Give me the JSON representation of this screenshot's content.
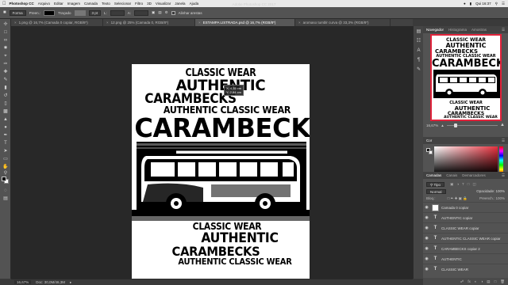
{
  "menubar": {
    "apple_icon": "apple-icon",
    "app_name": "Photoshop CC",
    "items": [
      "Arquivo",
      "Editar",
      "Imagem",
      "Camada",
      "Texto",
      "Selecionar",
      "Filtro",
      "3D",
      "Visualizar",
      "Janela",
      "Ajuda"
    ],
    "clock": "Qui 16:37"
  },
  "window_title": "Adobe Photoshop CC 2017",
  "options": {
    "mode_label": "Forma",
    "stroke_label": "Traçado",
    "stroke_size": "3 pt",
    "w_label": "L:",
    "h_label": "A:",
    "align_edges": "Alinhar arestas"
  },
  "tabs": [
    {
      "label": "1.png @ 16,7% (Camada 0 copiar, RGB/8*)",
      "active": false
    },
    {
      "label": "12.png @ 25% (Camada 0, RGB/8*)",
      "active": false
    },
    {
      "label": "ESTAMPA LISTRADA.psd @ 16,7% (RGB/8*)",
      "active": true
    },
    {
      "label": "aromaso tumblr curva @ 33,3% (RGB/8*)",
      "active": false
    }
  ],
  "canvas": {
    "lines": [
      "CLASSIC WEAR",
      "AUTHENTIC",
      "CARAMBECKS",
      "AUTHENTIC CLASSIC WEAR",
      "CARAMBECKS",
      "CLASSIC WEAR",
      "AUTHENTIC",
      "CARAMBECKS",
      "AUTHENTIC CLASSIC WEAR"
    ],
    "tooltip_x": "X: 4,35 cm",
    "tooltip_y": "Y: 2,84 cm"
  },
  "status": {
    "zoom": "16,67%",
    "doc": "Doc: 30,0M/46,3M"
  },
  "navigator": {
    "tabs": [
      "Navegador",
      "Histograma",
      "Amostras"
    ],
    "zoom": "16,67%",
    "zoom_level": 0.18
  },
  "color_panel": {
    "title": "Cor",
    "hue_level": 0.97,
    "hue_color": "#e8313e"
  },
  "layers": {
    "tabs": [
      "Camadas",
      "Canais",
      "Demarcadores"
    ],
    "filter": "Tipo",
    "mode": "Normal",
    "opacity": "Opacidade: 100%",
    "lock": "Bloq.:",
    "fill": "Preench.: 100%",
    "items": [
      {
        "name": "Camada 0 copiar",
        "kind": "image",
        "selected": false
      },
      {
        "name": "AUTHENTIC copiar",
        "kind": "text",
        "selected": false
      },
      {
        "name": "CLASSIC WEAR copiar",
        "kind": "text",
        "selected": false
      },
      {
        "name": "AUTHENTIC CLASSIC WEAR copiar",
        "kind": "text",
        "selected": false
      },
      {
        "name": "CARAMBECKS copiar 2",
        "kind": "text",
        "selected": false
      },
      {
        "name": "AUTHENTIC",
        "kind": "text",
        "selected": false
      },
      {
        "name": "CLASSIC WEAR",
        "kind": "text",
        "selected": false
      }
    ]
  }
}
